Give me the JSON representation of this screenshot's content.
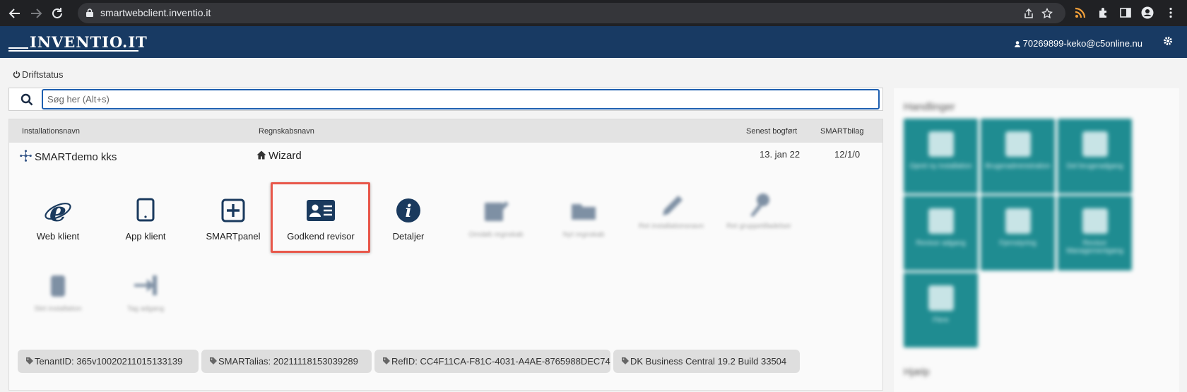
{
  "browser": {
    "url": "smartwebclient.inventio.it"
  },
  "header": {
    "logo": "INVENTIO.IT",
    "user_email": "70269899-keko@c5online.nu"
  },
  "status": {
    "label": "Driftstatus"
  },
  "search": {
    "placeholder": "Søg her (Alt+s)"
  },
  "table": {
    "columns": [
      "Installationsnavn",
      "Regnskabsnavn",
      "Senest bogført",
      "SMARTbilag"
    ],
    "row": {
      "installation": "SMARTdemo kks",
      "account": "Wizard",
      "last_posted": "13. jan 22",
      "smartbilag": "12/1/0"
    }
  },
  "actions": [
    {
      "label": "Web klient",
      "icon": "ie-browser-icon",
      "blurred": false
    },
    {
      "label": "App klient",
      "icon": "tablet-icon",
      "blurred": false
    },
    {
      "label": "SMARTpanel",
      "icon": "plus-square-icon",
      "blurred": false
    },
    {
      "label": "Godkend revisor",
      "icon": "id-card-icon",
      "blurred": false,
      "highlighted": true
    },
    {
      "label": "Detaljer",
      "icon": "info-circle-icon",
      "blurred": false
    },
    {
      "label": "Omdøb regnskab",
      "icon": "edit-icon",
      "blurred": true
    },
    {
      "label": "Nyt regnskab",
      "icon": "folder-icon",
      "blurred": true
    },
    {
      "label": "Ret installationsnavn",
      "icon": "pencil-icon",
      "blurred": true
    },
    {
      "label": "Ret gruppetilladelser",
      "icon": "key-icon",
      "blurred": true
    },
    {
      "label": "Slet installation",
      "icon": "trash-icon",
      "blurred": true
    },
    {
      "label": "Tag adgang",
      "icon": "sign-in-icon",
      "blurred": true
    }
  ],
  "chips": [
    {
      "label": "TenantID: 365v10020211015133139"
    },
    {
      "label": "SMARTalias: 20211118153039289"
    },
    {
      "label": "RefID: CC4F11CA-F81C-4031-A4AE-8765988DEC74"
    },
    {
      "label": "DK Business Central 19.2 Build 33504"
    }
  ],
  "sidebar": {
    "heading": "Handlinger",
    "tiles": [
      {
        "label": "Opret ny installation"
      },
      {
        "label": "Brugeradministration"
      },
      {
        "label": "Del brugeradgang"
      },
      {
        "label": "Revisor adgang"
      },
      {
        "label": "Fjernstyring"
      },
      {
        "label": "Revisor Managementgang"
      },
      {
        "label": "Flere"
      }
    ],
    "heading2": "Hjælp"
  },
  "colors": {
    "header_bg": "#183a63",
    "sidebar_tile": "#1f8c91",
    "highlight": "#e8574a",
    "search_border": "#1e5fb0"
  }
}
